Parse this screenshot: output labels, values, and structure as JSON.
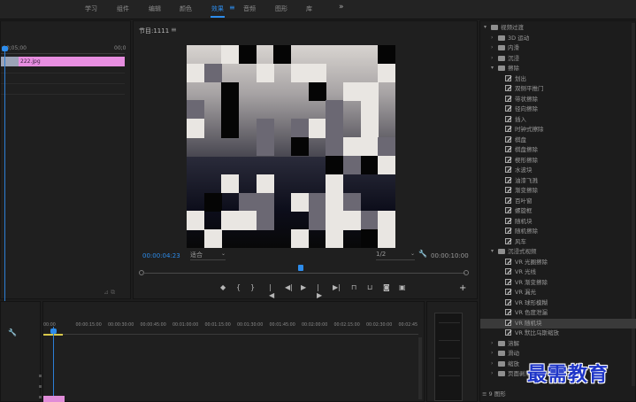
{
  "workspaces": [
    {
      "label": "学习",
      "active": false
    },
    {
      "label": "组件",
      "active": false
    },
    {
      "label": "编辑",
      "active": false
    },
    {
      "label": "颜色",
      "active": false
    },
    {
      "label": "效果",
      "active": true
    },
    {
      "label": "音频",
      "active": false
    },
    {
      "label": "图形",
      "active": false
    },
    {
      "label": "库",
      "active": false
    }
  ],
  "workspace_menu_icon": "≡",
  "workspace_more": "»",
  "source": {
    "timecode_left": "00;05;00",
    "timecode_right": "00;0",
    "clip_label": "222.jpg",
    "footer_icons": "⊿  ⧉"
  },
  "program": {
    "title": "节目:1111",
    "menu_icon": "≡",
    "timecode_current": "00:00:04:23",
    "fit_value": "适合",
    "resolution_value": "1/2",
    "timecode_total": "00:00:10:00",
    "transport_buttons": [
      {
        "name": "marker-button",
        "glyph": "◆"
      },
      {
        "name": "in-point-button",
        "glyph": "{"
      },
      {
        "name": "out-point-button",
        "glyph": "}"
      },
      {
        "name": "go-to-in-button",
        "glyph": "|◀"
      },
      {
        "name": "step-back-button",
        "glyph": "◀|"
      },
      {
        "name": "play-button",
        "glyph": "▶"
      },
      {
        "name": "step-forward-button",
        "glyph": "|▶"
      },
      {
        "name": "go-to-out-button",
        "glyph": "▶|"
      },
      {
        "name": "lift-button",
        "glyph": "⊓"
      },
      {
        "name": "extract-button",
        "glyph": "⊔"
      },
      {
        "name": "export-frame-button",
        "glyph": "◙"
      },
      {
        "name": "compare-button",
        "glyph": "▣"
      }
    ],
    "add_button": "+"
  },
  "effects": {
    "items": [
      {
        "level": 0,
        "kind": "folder",
        "open": true,
        "label": "视频过渡"
      },
      {
        "level": 1,
        "kind": "folder",
        "open": false,
        "label": "3D 运动"
      },
      {
        "level": 1,
        "kind": "folder",
        "open": false,
        "label": "内滑"
      },
      {
        "level": 1,
        "kind": "folder",
        "open": false,
        "label": "沉浸"
      },
      {
        "level": 1,
        "kind": "folder",
        "open": true,
        "label": "擦除"
      },
      {
        "level": 2,
        "kind": "preset",
        "label": "划出"
      },
      {
        "level": 2,
        "kind": "preset",
        "label": "双侧平推门"
      },
      {
        "level": 2,
        "kind": "preset",
        "label": "带状擦除"
      },
      {
        "level": 2,
        "kind": "preset",
        "label": "径向擦除"
      },
      {
        "level": 2,
        "kind": "preset",
        "label": "插入"
      },
      {
        "level": 2,
        "kind": "preset",
        "label": "时钟式擦除"
      },
      {
        "level": 2,
        "kind": "preset",
        "label": "棋盘"
      },
      {
        "level": 2,
        "kind": "preset",
        "label": "棋盘擦除"
      },
      {
        "level": 2,
        "kind": "preset",
        "label": "楔形擦除"
      },
      {
        "level": 2,
        "kind": "preset",
        "label": "水波块"
      },
      {
        "level": 2,
        "kind": "preset",
        "label": "油漆飞溅"
      },
      {
        "level": 2,
        "kind": "preset",
        "label": "渐变擦除"
      },
      {
        "level": 2,
        "kind": "preset",
        "label": "百叶窗"
      },
      {
        "level": 2,
        "kind": "preset",
        "label": "螺旋框"
      },
      {
        "level": 2,
        "kind": "preset",
        "label": "随机块"
      },
      {
        "level": 2,
        "kind": "preset",
        "label": "随机擦除"
      },
      {
        "level": 2,
        "kind": "preset",
        "label": "风车"
      },
      {
        "level": 1,
        "kind": "folder",
        "open": true,
        "label": "沉浸式视频"
      },
      {
        "level": 2,
        "kind": "preset",
        "tag": "VR",
        "label": "VR 光圈擦除"
      },
      {
        "level": 2,
        "kind": "preset",
        "tag": "VR",
        "label": "VR 光线"
      },
      {
        "level": 2,
        "kind": "preset",
        "tag": "VR",
        "label": "VR 渐变擦除"
      },
      {
        "level": 2,
        "kind": "preset",
        "tag": "VR",
        "label": "VR 漏光"
      },
      {
        "level": 2,
        "kind": "preset",
        "tag": "VR",
        "label": "VR 球形模糊"
      },
      {
        "level": 2,
        "kind": "preset",
        "tag": "VR",
        "label": "VR 色度泄漏"
      },
      {
        "level": 2,
        "kind": "preset",
        "tag": "VR",
        "label": "VR 随机块",
        "selected": true
      },
      {
        "level": 2,
        "kind": "preset",
        "tag": "VR",
        "label": "VR 默比乌斯缩放"
      },
      {
        "level": 1,
        "kind": "folder",
        "open": false,
        "label": "溶解"
      },
      {
        "level": 1,
        "kind": "folder",
        "open": false,
        "label": "滑动"
      },
      {
        "level": 1,
        "kind": "folder",
        "open": false,
        "label": "缩放"
      },
      {
        "level": 1,
        "kind": "folder",
        "open": false,
        "label": "页面剥落"
      }
    ],
    "footer": "≡ 9 图形"
  },
  "timeline": {
    "ticks": [
      "00:00",
      "00:00:15:00",
      "00:00:30:00",
      "00:00:45:00",
      "00:01:00:00",
      "00:01:15:00",
      "00:01:30:00",
      "00:01:45:00",
      "00:02:00:00",
      "00:02:15:00",
      "00:02:30:00",
      "00:02:45"
    ]
  },
  "watermark": "最需教育",
  "colors": {
    "accent": "#2d8ceb",
    "clip_pink": "#e78ee0",
    "watermark": "#1e35c8"
  }
}
